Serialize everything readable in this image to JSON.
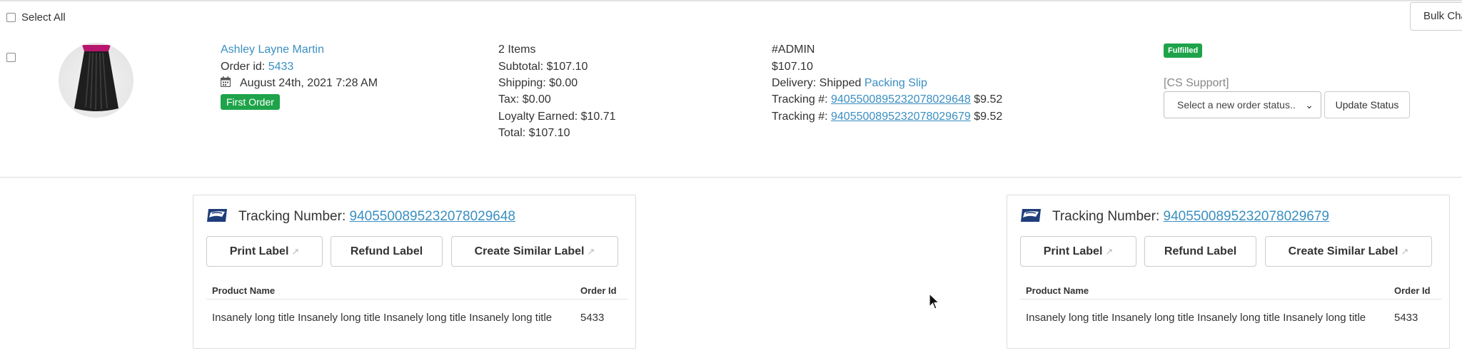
{
  "toolbar": {
    "select_all_label": "Select All",
    "bulk_change_label": "Bulk Cha"
  },
  "order": {
    "customer_name": "Ashley Layne Martin",
    "order_id_label": "Order id:",
    "order_id": "5433",
    "date": "August 24th, 2021 7:28 AM",
    "first_order_badge": "First Order",
    "items_count": "2 Items",
    "subtotal": "Subtotal: $107.10",
    "shipping": "Shipping: $0.00",
    "tax": "Tax: $0.00",
    "loyalty": "Loyalty Earned: $10.71",
    "total": "Total: $107.10",
    "admin_tag": "#ADMIN",
    "amount": "$107.10",
    "delivery_label": "Delivery: Shipped",
    "packing_slip": "Packing Slip",
    "tracking_label": "Tracking #:",
    "tracking_1": "9405500895232078029648",
    "tracking_1_cost": "$9.52",
    "tracking_2": "9405500895232078029679",
    "tracking_2_cost": "$9.52",
    "status_badge": "Fulfilled",
    "cs_support": "[CS Support]",
    "status_select_placeholder": "Select a new order status..",
    "update_status_label": "Update Status"
  },
  "labels": [
    {
      "tracking_title": "Tracking Number:",
      "tracking_number": "9405500895232078029648",
      "print_label": "Print Label",
      "refund_label": "Refund Label",
      "similar_label": "Create Similar Label",
      "col_product": "Product Name",
      "col_order_id": "Order Id",
      "product_name": "Insanely long title Insanely long title Insanely long title Insanely long title",
      "order_id": "5433"
    },
    {
      "tracking_title": "Tracking Number:",
      "tracking_number": "9405500895232078029679",
      "print_label": "Print Label",
      "refund_label": "Refund Label",
      "similar_label": "Create Similar Label",
      "col_product": "Product Name",
      "col_order_id": "Order Id",
      "product_name": "Insanely long title Insanely long title Insanely long title Insanely long title",
      "order_id": "5433"
    }
  ],
  "colors": {
    "link": "#3a8fc2",
    "success": "#1ea34a",
    "usps_blue": "#1f3d7a"
  },
  "icons": [
    "calendar-icon",
    "external-link-icon",
    "usps-logo-icon",
    "chevron-down-icon",
    "mouse-cursor-icon"
  ]
}
